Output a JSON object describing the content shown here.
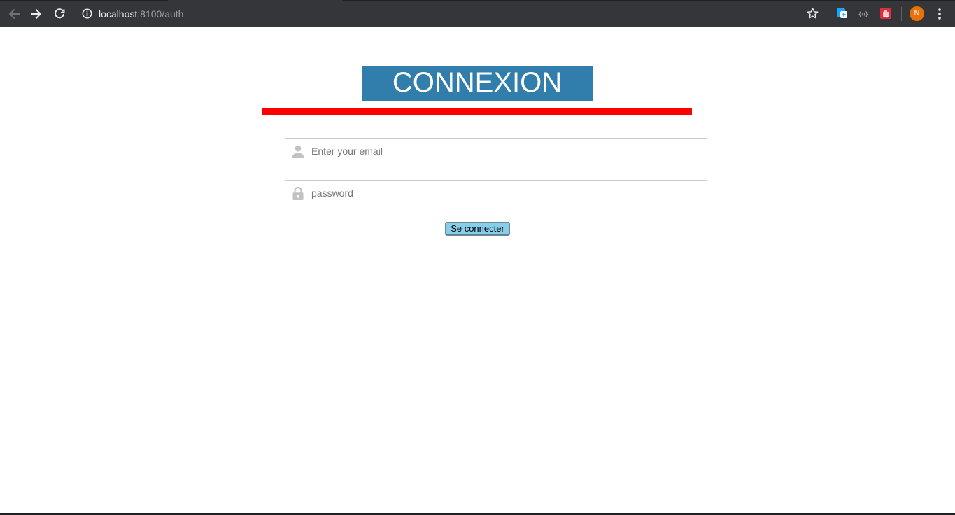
{
  "browser": {
    "url_host": "localhost",
    "url_rest": ":8100/auth",
    "profile_initial": "N",
    "ext_icons": [
      "translate-extension-icon",
      "json-viewer-extension-icon",
      "adblock-extension-icon"
    ]
  },
  "page": {
    "title": "CONNEXION",
    "email": {
      "placeholder": "Enter your email",
      "value": ""
    },
    "password": {
      "placeholder": "password",
      "value": ""
    },
    "submit_label": "Se connecter"
  },
  "colors": {
    "title_bg": "#317eac",
    "underline": "#ff0000",
    "button_bg": "#87ceeb",
    "chrome_bg": "#35363a"
  }
}
